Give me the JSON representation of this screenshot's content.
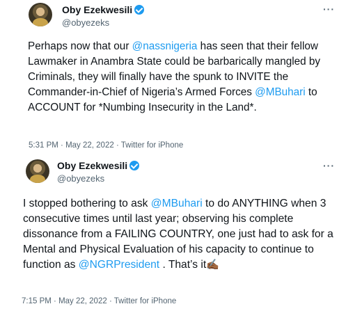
{
  "tweets": [
    {
      "name": "Oby Ezekwesili",
      "handle": "@obyezeks",
      "more_label": "···",
      "body_parts": [
        {
          "text": "Perhaps now that our ",
          "mention": false
        },
        {
          "text": "@nassnigeria",
          "mention": true
        },
        {
          "text": " has seen that their fellow Lawmaker in Anambra State could be barbarically mangled by Criminals, they will finally have the spunk to INVITE the Commander-in-Chief of Nigeria’s Armed Forces ",
          "mention": false
        },
        {
          "text": "@MBuhari",
          "mention": true
        },
        {
          "text": " to ACCOUNT for *Numbing Insecurity in the Land*.",
          "mention": false
        }
      ],
      "time": "5:31 PM",
      "date": "May 22, 2022",
      "source": "Twitter for iPhone"
    },
    {
      "name": "Oby Ezekwesili",
      "handle": "@obyezeks",
      "more_label": "···",
      "body_parts": [
        {
          "text": "I stopped bothering to ask ",
          "mention": false
        },
        {
          "text": "@MBuhari",
          "mention": true
        },
        {
          "text": " to do ANYTHING when 3 consecutive times until last year; observing his complete dissonance from a FAILING COUNTRY, one just had to ask for a Mental and Physical Evaluation of his capacity to continue to function as ",
          "mention": false
        },
        {
          "text": "@NGRPresident",
          "mention": true
        },
        {
          "text": " . That’s it",
          "mention": false
        },
        {
          "text": "✍🏾",
          "mention": false,
          "emoji": true
        }
      ],
      "time": "7:15 PM",
      "date": "May 22, 2022",
      "source": "Twitter for iPhone"
    }
  ],
  "meta_separator": " · ",
  "colors": {
    "accent": "#1d9bf0",
    "text": "#0f1419",
    "secondary": "#536471"
  }
}
